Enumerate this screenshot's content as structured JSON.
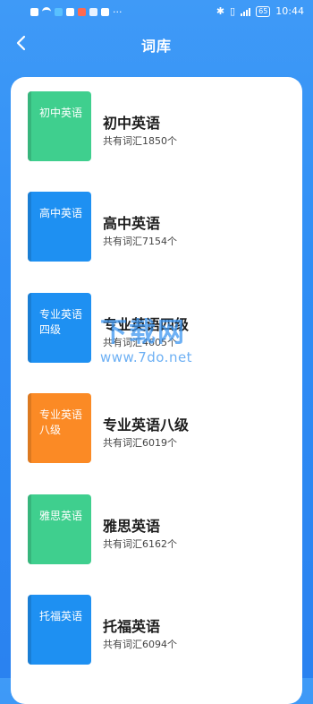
{
  "status_bar": {
    "battery": "65",
    "time": "10:44"
  },
  "header": {
    "title": "词库",
    "back_icon": "chevron-left-icon"
  },
  "books": [
    {
      "cover_text": "初中英语",
      "name": "初中英语",
      "count": "共有词汇1850个",
      "color": "#3fcf8e"
    },
    {
      "cover_text": "高中英语",
      "name": "高中英语",
      "count": "共有词汇7154个",
      "color": "#1e90f2"
    },
    {
      "cover_text": "专业英语四级",
      "name": "专业英语四级",
      "count": "共有词汇4605个",
      "color": "#1e90f2"
    },
    {
      "cover_text": "专业英语八级",
      "name": "专业英语八级",
      "count": "共有词汇6019个",
      "color": "#fb8a25"
    },
    {
      "cover_text": "雅思英语",
      "name": "雅思英语",
      "count": "共有词汇6162个",
      "color": "#3fcf8e"
    },
    {
      "cover_text": "托福英语",
      "name": "托福英语",
      "count": "共有词汇6094个",
      "color": "#1e90f2"
    }
  ],
  "watermark": {
    "text": "下载网",
    "url": "www.7do.net"
  }
}
